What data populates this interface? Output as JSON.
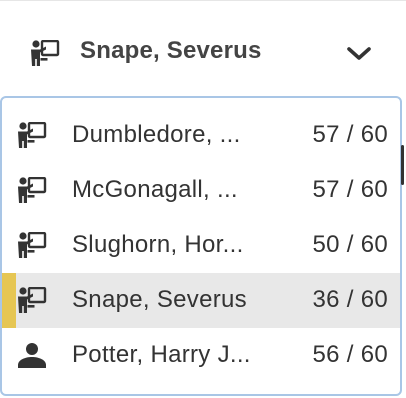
{
  "selector": {
    "icon": "teacher-icon",
    "label": "Snape, Severus",
    "chevron": "chevron-down-icon"
  },
  "list": {
    "items": [
      {
        "icon": "teacher-icon",
        "name": "Dumbledore, ...",
        "score": "57 / 60",
        "selected": false
      },
      {
        "icon": "teacher-icon",
        "name": "McGonagall, ...",
        "score": "57 / 60",
        "selected": false
      },
      {
        "icon": "teacher-icon",
        "name": "Slughorn, Hor...",
        "score": "50 / 60",
        "selected": false
      },
      {
        "icon": "teacher-icon",
        "name": "Snape, Severus",
        "score": "36 / 60",
        "selected": true
      },
      {
        "icon": "person-icon",
        "name": "Potter, Harry J...",
        "score": "56 / 60",
        "selected": false
      }
    ]
  },
  "colors": {
    "selected_marker": "#e6c653",
    "selected_bg": "#e8e8e8",
    "border": "#a9c6e6",
    "icon": "#333333"
  }
}
